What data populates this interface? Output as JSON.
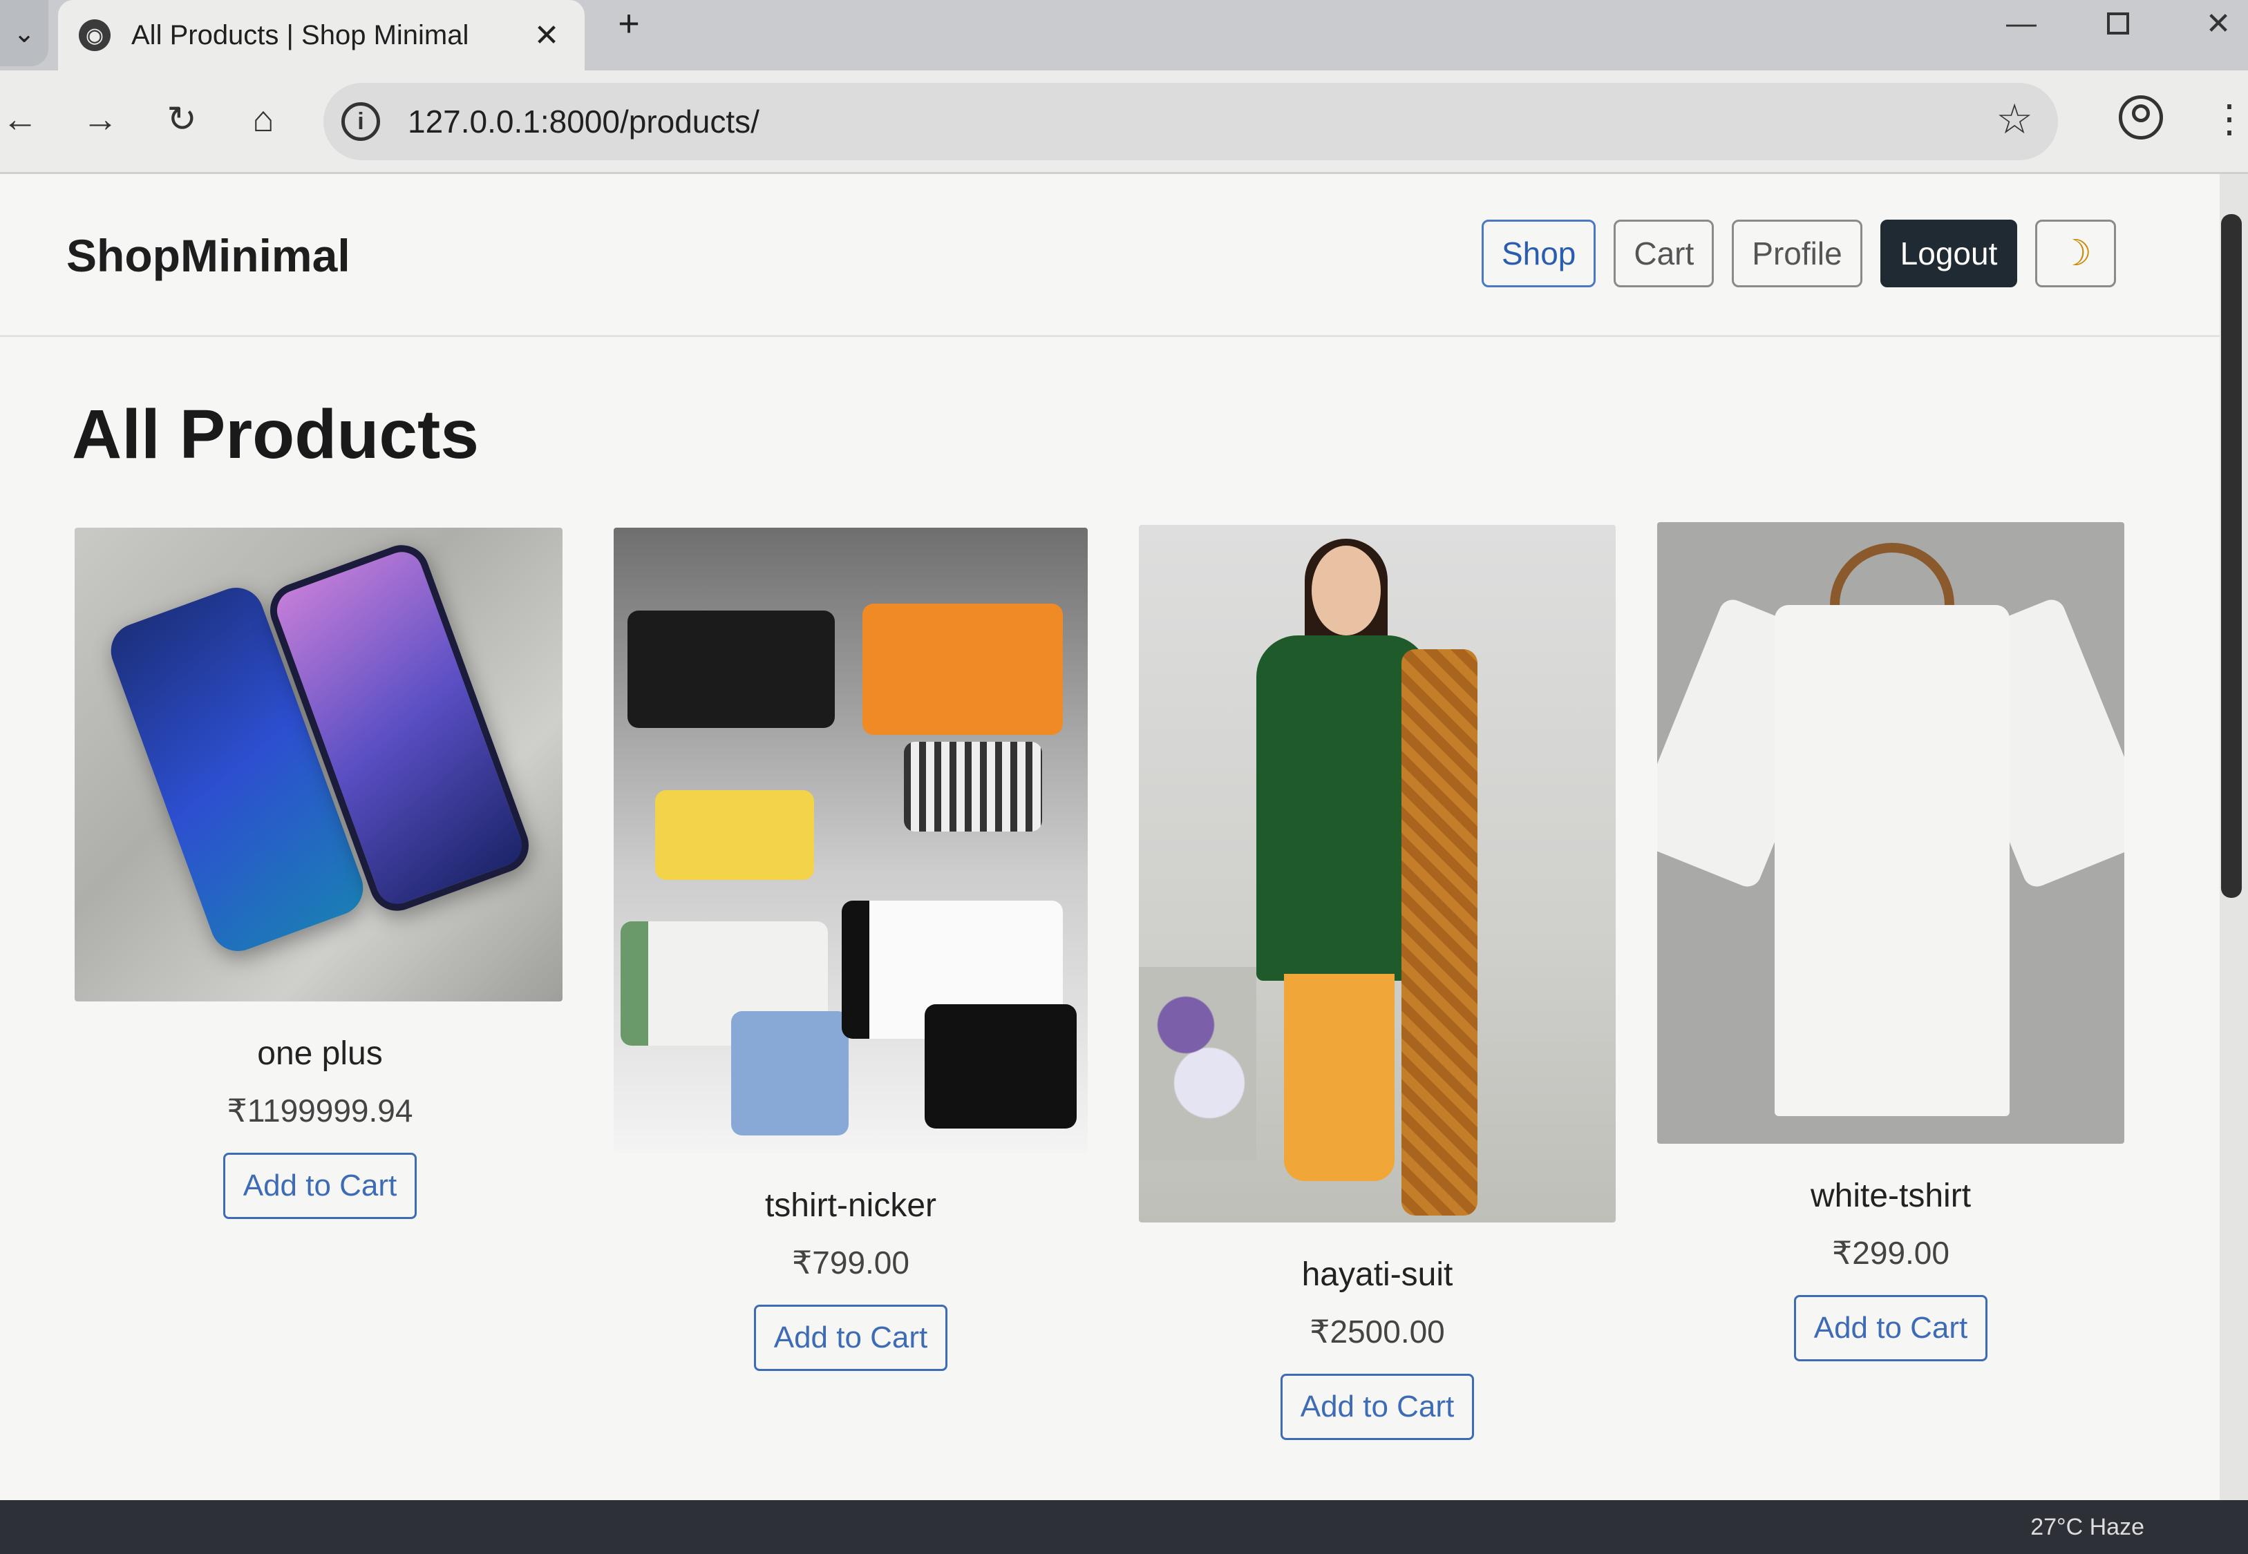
{
  "browser": {
    "tab_title": "All Products | Shop Minimal",
    "tab_close_glyph": "✕",
    "new_tab_glyph": "+",
    "url": "127.0.0.1:8000/products/",
    "icons": [
      "tab-list-icon",
      "globe-icon",
      "close-icon",
      "plus-icon",
      "minimize-icon",
      "maximize-icon",
      "close-window-icon",
      "back-arrow-icon",
      "forward-arrow-icon",
      "reload-icon",
      "home-icon",
      "info-icon",
      "star-icon",
      "profile-icon",
      "more-vertical-icon"
    ]
  },
  "site": {
    "brand": "ShopMinimal",
    "nav": {
      "shop": "Shop",
      "cart": "Cart",
      "profile": "Profile",
      "logout": "Logout",
      "theme_toggle_icon": "moon-icon"
    },
    "page_title": "All Products",
    "accent_color": "#3e6bb6",
    "dark_button_color": "#1f2a33"
  },
  "products": [
    {
      "name": "one plus",
      "price": "₹1199999.94",
      "button": "Add to Cart",
      "image": "phone-image"
    },
    {
      "name": "tshirt-nicker",
      "price": "₹799.00",
      "button": "Add to Cart",
      "image": "kids-clothes-image"
    },
    {
      "name": "hayati-suit",
      "price": "₹2500.00",
      "button": "Add to Cart",
      "image": "suit-image"
    },
    {
      "name": "white-tshirt",
      "price": "₹299.00",
      "button": "Add to Cart",
      "image": "tshirt-image"
    }
  ],
  "taskbar": {
    "status": "27°C  Haze"
  }
}
